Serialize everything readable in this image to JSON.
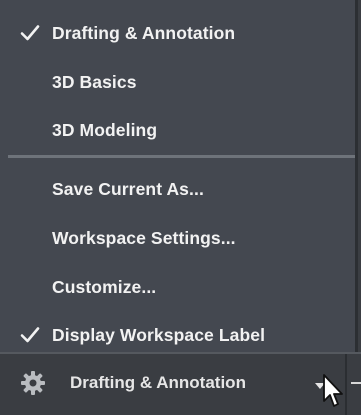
{
  "workspace_menu": {
    "items": [
      {
        "label": "Drafting & Annotation",
        "checked": true,
        "icon": "checkmark-icon"
      },
      {
        "label": "3D Basics",
        "checked": false
      },
      {
        "label": "3D Modeling",
        "checked": false
      },
      {
        "label": "Save Current As...",
        "checked": false
      },
      {
        "label": "Workspace Settings...",
        "checked": false
      },
      {
        "label": "Customize...",
        "checked": false
      },
      {
        "label": "Display Workspace Label",
        "checked": true,
        "icon": "checkmark-icon"
      }
    ]
  },
  "status_bar": {
    "workspace_label": "Drafting & Annotation",
    "gear_icon": "gear-icon",
    "dropdown_icon": "chevron-down-icon"
  },
  "colors": {
    "menu_bg": "#444850",
    "text": "#f2f2f2",
    "separator": "#6e737a",
    "statusbar_bg": "#3a3d42"
  }
}
